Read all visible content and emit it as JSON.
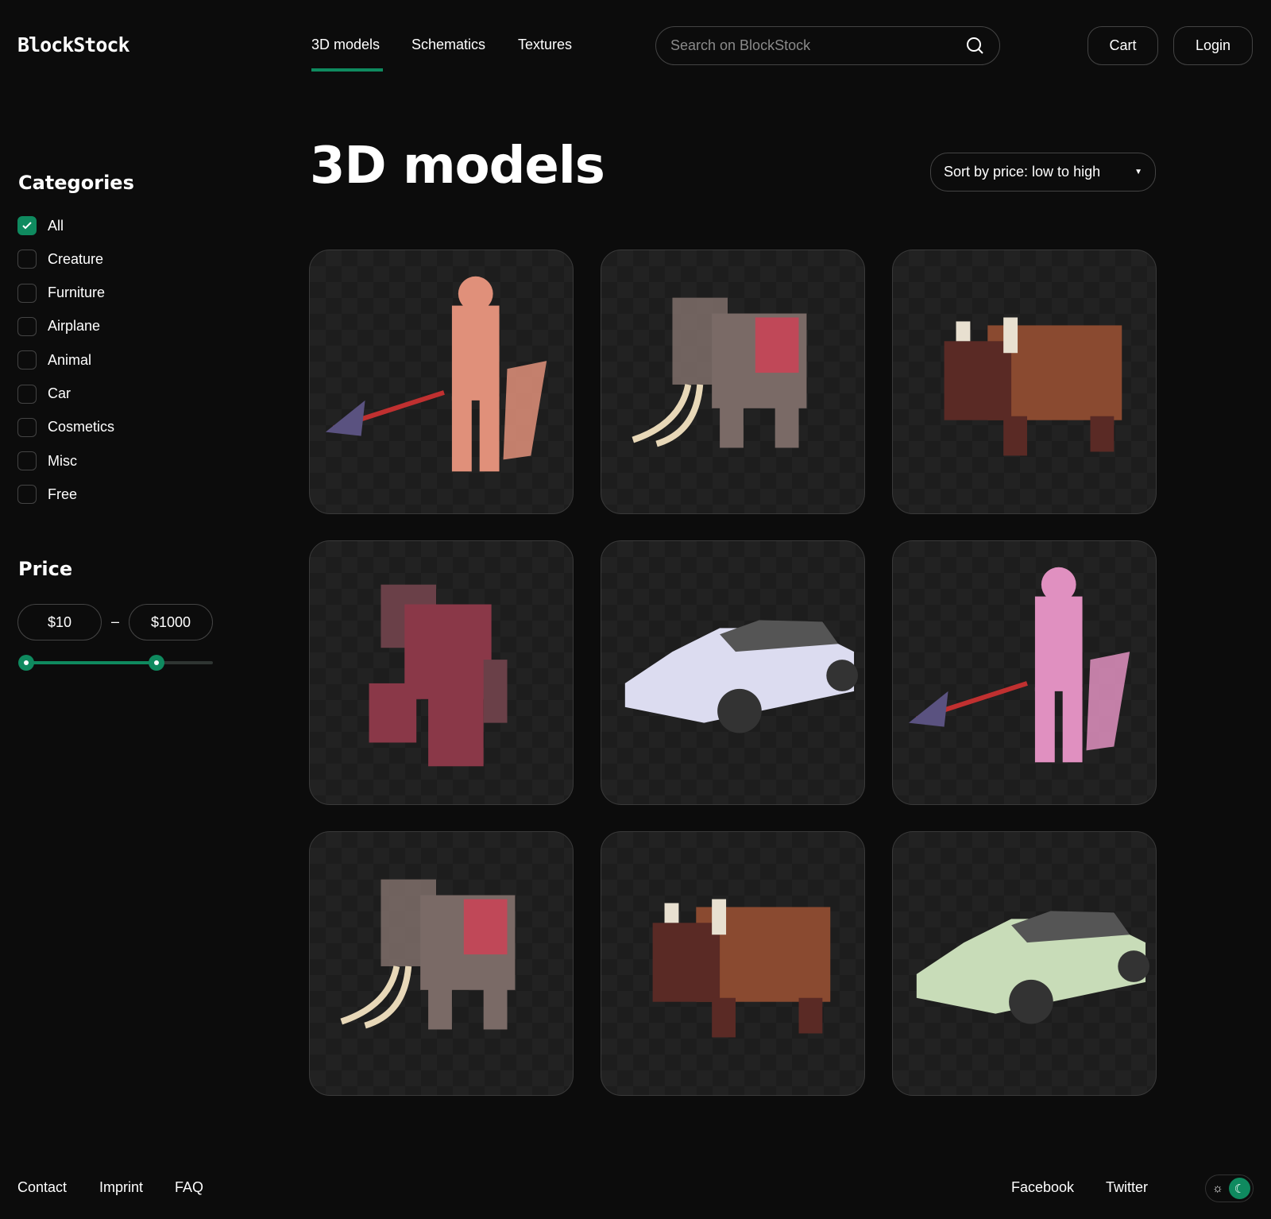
{
  "header": {
    "logo": "BlockStock",
    "nav": [
      {
        "label": "3D models",
        "active": true
      },
      {
        "label": "Schematics"
      },
      {
        "label": "Textures"
      }
    ],
    "search_placeholder": "Search on BlockStock",
    "cart": "Cart",
    "login": "Login"
  },
  "main": {
    "title": "3D models",
    "sort": "Sort by price: low to high"
  },
  "sidebar": {
    "categories_title": "Categories",
    "categories": [
      {
        "label": "All",
        "checked": true
      },
      {
        "label": "Creature",
        "checked": false
      },
      {
        "label": "Furniture",
        "checked": false
      },
      {
        "label": "Airplane",
        "checked": false
      },
      {
        "label": "Animal",
        "checked": false
      },
      {
        "label": "Car",
        "checked": false
      },
      {
        "label": "Cosmetics",
        "checked": false
      },
      {
        "label": "Misc",
        "checked": false
      },
      {
        "label": "Free",
        "checked": false
      }
    ],
    "price_title": "Price",
    "price_min": "$10",
    "price_max": "$1000",
    "separator": "–",
    "slider_low": 0,
    "slider_high": 0.7
  },
  "products": [
    {
      "kind": "warrior",
      "color": "#e0907a"
    },
    {
      "kind": "elephant",
      "color": "#7a6a66"
    },
    {
      "kind": "bison",
      "color": "#8a4a30"
    },
    {
      "kind": "golem",
      "color": "#8a3848"
    },
    {
      "kind": "car",
      "color": "#dcdcf0"
    },
    {
      "kind": "warrior",
      "color": "#e090c0"
    },
    {
      "kind": "elephant",
      "color": "#7a6a66"
    },
    {
      "kind": "bison",
      "color": "#8a4a30"
    },
    {
      "kind": "car",
      "color": "#c8dcb8"
    }
  ],
  "footer": {
    "links": [
      "Contact",
      "Imprint",
      "FAQ"
    ],
    "social": [
      "Facebook",
      "Twitter"
    ],
    "theme": "dark"
  },
  "colors": {
    "accent": "#0f8a5f",
    "background": "#0c0c0c"
  }
}
